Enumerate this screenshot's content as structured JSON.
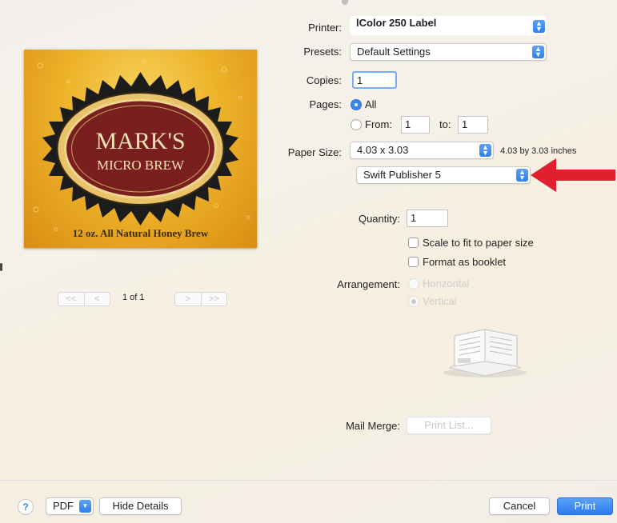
{
  "printer": {
    "label": "Printer:",
    "value": "lColor 250 Label"
  },
  "presets": {
    "label": "Presets:",
    "value": "Default Settings"
  },
  "copies": {
    "label": "Copies:",
    "value": "1"
  },
  "pages": {
    "label": "Pages:",
    "all_label": "All",
    "from_label": "From:",
    "from_value": "1",
    "to_label": "to:",
    "to_value": "1"
  },
  "paper_size": {
    "label": "Paper Size:",
    "value": "4.03 x 3.03",
    "description": "4.03 by 3.03 inches"
  },
  "app_popup": {
    "value": "Swift Publisher 5"
  },
  "quantity": {
    "label": "Quantity:",
    "value": "1"
  },
  "options": {
    "scale_label": "Scale to fit to paper size",
    "booklet_label": "Format as booklet"
  },
  "arrangement": {
    "label": "Arrangement:",
    "horizontal_label": "Horizontal",
    "vertical_label": "Vertical"
  },
  "mail_merge": {
    "label": "Mail Merge:",
    "button_label": "Print List..."
  },
  "preview": {
    "page_indicator": "1 of 1",
    "first_label": "<<",
    "prev_label": "<",
    "next_label": ">",
    "last_label": ">>",
    "label_title": "MARK'S",
    "label_subtitle": "MICRO BREW",
    "label_footer": "12 oz. All Natural Honey Brew"
  },
  "footer": {
    "help_label": "?",
    "pdf_label": "PDF",
    "hide_details_label": "Hide Details",
    "cancel_label": "Cancel",
    "print_label": "Print"
  },
  "colors": {
    "accent": "#2f7ef1",
    "arrow": "#e0202f",
    "label_gold": "#e6a21a",
    "label_maroon": "#7a1f1f"
  },
  "icons": {
    "stepper": "up-down-chevron-icon",
    "arrow": "red-arrow-icon",
    "booklet": "booklet-preview-icon"
  }
}
